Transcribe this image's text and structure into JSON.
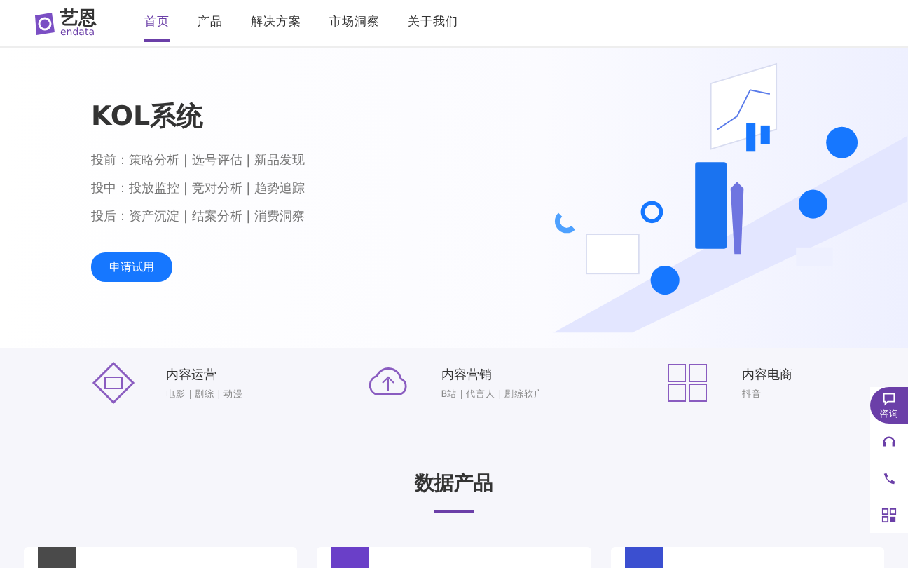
{
  "header": {
    "logo_text": "艺恩",
    "logo_sub": "endata",
    "nav": [
      {
        "label": "首页",
        "selected": true
      },
      {
        "label": "产品",
        "selected": false
      },
      {
        "label": "解决方案",
        "selected": false
      },
      {
        "label": "市场洞察",
        "selected": false
      },
      {
        "label": "关于我们",
        "selected": false
      }
    ]
  },
  "hero": {
    "title": "KOL系统",
    "lines": [
      "投前：策略分析 | 选号评估 | 新品发现",
      "投中：投放监控 | 竞对分析 | 趋势追踪",
      "投后：资产沉淀 | 结案分析 | 消费洞察"
    ],
    "button": "申请试用"
  },
  "features": [
    {
      "kind": "screen",
      "title": "内容运营",
      "subtitle": "电影 | 剧综 | 动漫"
    },
    {
      "kind": "cloud",
      "title": "内容营销",
      "subtitle": "B站 | 代言人 | 剧综软广"
    },
    {
      "kind": "grid",
      "title": "内容电商",
      "subtitle": "抖音"
    }
  ],
  "side_tools": [
    {
      "kind": "chat",
      "label": "咨询"
    },
    {
      "kind": "headset"
    },
    {
      "kind": "phone"
    },
    {
      "kind": "qr"
    }
  ],
  "section": {
    "title": "数据产品"
  },
  "cards": [
    {
      "color": "#4a4a4a"
    },
    {
      "color": "#6a3fc8"
    },
    {
      "color": "#3b4fd0"
    }
  ]
}
